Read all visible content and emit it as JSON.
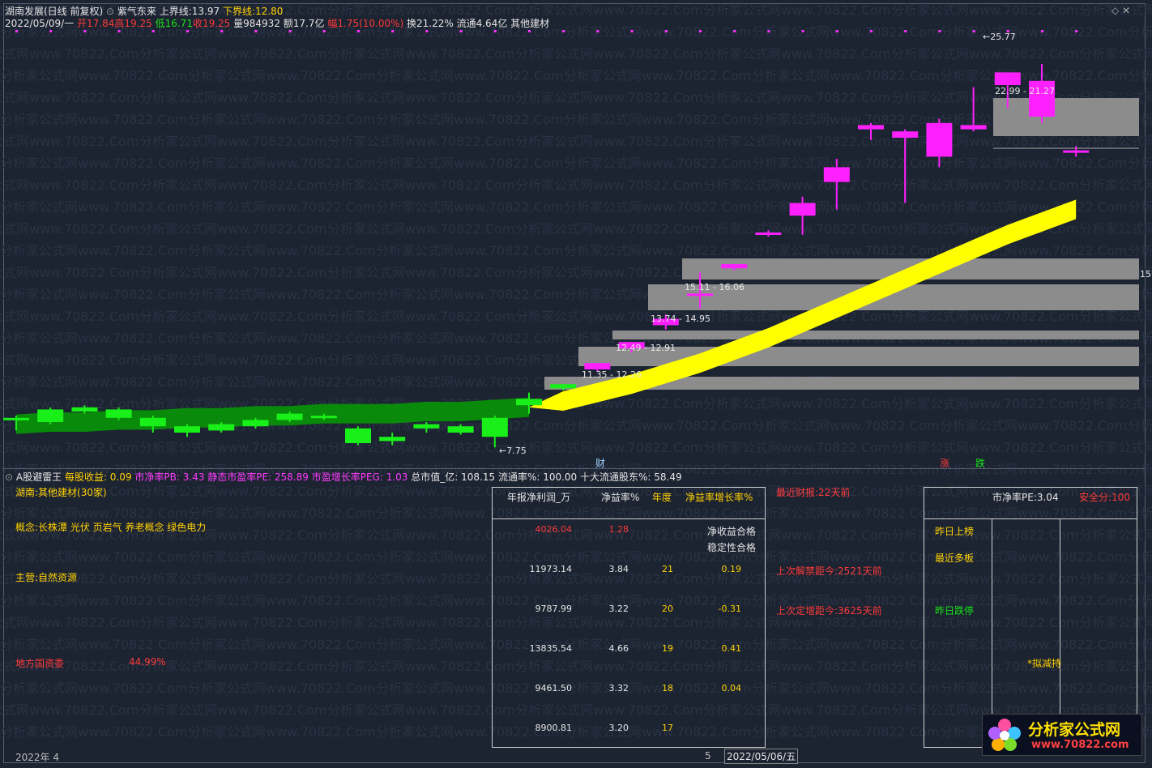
{
  "header": {
    "stock_name": "湖南发展(日线 前复权)",
    "indicator_name": "紫气东来",
    "upper_label": "上界线:",
    "upper_value": "13.97",
    "lower_label": "下界线:",
    "lower_value": "12.80",
    "date": "2022/05/09/一",
    "open": "开17.84",
    "high": "高19.25",
    "low": "低16.71",
    "close": "收19.25",
    "volume": "量984932",
    "amount": "额17.7亿",
    "change": "幅1.75(10.00%)",
    "turnover": "换21.22%",
    "float_value": "流通4.64亿",
    "sector": "其他建材"
  },
  "price_labels": {
    "top": "25.77",
    "bottom": "7.75",
    "z1": "22.99 - 21.27",
    "z2": "15.11 - 16.06",
    "z3": "13.74 - 14.95",
    "z4": "12.49 - 12.91",
    "z5": "11.35 - 12.26",
    "right_cut": "15"
  },
  "markers": {
    "cai": "财",
    "zhang": "涨",
    "die": "跌"
  },
  "watermark": "分析家公式网www.70822.Com",
  "chart_data": {
    "type": "candlestick",
    "series": [
      {
        "name": "k",
        "ohlc": [
          [
            7.6,
            7.8,
            7.1,
            7.7
          ],
          [
            7.5,
            8.2,
            7.4,
            8.1
          ],
          [
            8.0,
            8.3,
            7.9,
            8.2
          ],
          [
            8.1,
            8.2,
            7.6,
            7.7
          ],
          [
            7.7,
            7.8,
            7.0,
            7.3
          ],
          [
            7.3,
            7.4,
            6.8,
            7.0
          ],
          [
            7.1,
            7.5,
            7.0,
            7.4
          ],
          [
            7.3,
            7.7,
            7.2,
            7.6
          ],
          [
            7.6,
            8.0,
            7.5,
            7.9
          ],
          [
            7.8,
            7.9,
            7.6,
            7.7
          ],
          [
            7.2,
            7.3,
            6.4,
            6.5
          ],
          [
            6.8,
            7.0,
            6.4,
            6.6
          ],
          [
            7.2,
            7.5,
            7.0,
            7.4
          ],
          [
            7.0,
            7.4,
            6.9,
            7.3
          ],
          [
            7.7,
            7.8,
            6.3,
            6.8
          ],
          [
            8.6,
            8.9,
            7.9,
            8.3
          ],
          [
            9.1,
            9.3,
            9.0,
            9.3
          ],
          [
            10.0,
            10.3,
            9.9,
            10.3
          ],
          [
            11.0,
            11.3,
            10.8,
            11.3
          ],
          [
            12.1,
            12.6,
            11.9,
            12.4
          ],
          [
            13.6,
            14.6,
            12.9,
            13.6
          ],
          [
            14.8,
            15.0,
            14.7,
            15.0
          ],
          [
            16.4,
            16.6,
            16.3,
            16.5
          ],
          [
            17.3,
            18.2,
            16.4,
            17.9
          ],
          [
            18.9,
            20.0,
            17.6,
            19.6
          ],
          [
            21.6,
            21.7,
            20.9,
            21.4
          ],
          [
            21.0,
            21.4,
            17.9,
            21.3
          ],
          [
            20.1,
            21.9,
            19.6,
            21.7
          ],
          [
            21.6,
            23.4,
            21.3,
            21.4
          ],
          [
            23.5,
            24.1,
            22.4,
            24.1
          ],
          [
            23.7,
            24.5,
            21.7,
            22.0
          ],
          [
            20.4,
            20.6,
            20.1,
            20.4
          ]
        ]
      }
    ],
    "lines": [
      {
        "name": "band",
        "values": [
          7.4,
          7.5,
          7.5,
          7.6,
          7.6,
          7.7,
          7.7,
          7.8,
          7.8,
          7.9,
          7.9,
          7.9,
          8.0,
          8.0,
          8.1,
          8.2,
          8.5,
          8.9,
          9.3,
          9.8,
          10.3,
          10.9,
          11.5,
          12.2,
          12.9,
          13.6,
          14.3,
          15.0,
          15.7,
          16.4,
          17.0,
          17.6
        ]
      }
    ],
    "zones": [
      [
        "11.35",
        "12.26"
      ],
      [
        "12.49",
        "12.91"
      ],
      [
        "13.74",
        "14.95"
      ],
      [
        "15.11",
        "16.06"
      ],
      [
        "22.99",
        "21.27"
      ]
    ],
    "ylim": [
      6,
      26
    ],
    "xlabel_left": "2022年 4",
    "xlabel_mid": "5",
    "xlabel_right": "2022/05/06/五"
  },
  "bottom": {
    "title": "A股避雷王",
    "eps": "每股收益: 0.09",
    "pb": "市净率PB: 3.43",
    "pe": "静态市盈率PE: 258.89",
    "peg": "市盈增长率PEG: 1.03",
    "mcap": "总市值_亿: 108.15",
    "float_rate": "流通率%: 100.00",
    "top10": "十大流通股东%: 58.49",
    "region": "湖南:其他建材(30家)",
    "concept": "概念:长株潭 光伏 页岩气 养老概念 绿色电力",
    "main_biz": "主营:自然资源",
    "owner": "地方国资委",
    "owner_pct": "44.99%"
  },
  "table": {
    "headers": [
      "年报净利润_万",
      "净益率%",
      "年度",
      "净益率增长率%"
    ],
    "status1": "净收益合格",
    "status2": "稳定性合格",
    "rows": [
      [
        "4026.04",
        "1.28",
        "",
        ""
      ],
      [
        "11973.14",
        "3.84",
        "21",
        "0.19"
      ],
      [
        "9787.99",
        "3.22",
        "20",
        "-0.31"
      ],
      [
        "13835.54",
        "4.66",
        "19",
        "0.41"
      ],
      [
        "9461.50",
        "3.32",
        "18",
        "0.04"
      ],
      [
        "8900.81",
        "3.20",
        "17",
        ""
      ]
    ]
  },
  "mid_info": {
    "report": "最近财报:22天前",
    "unlock": "上次解禁距今:2521天前",
    "placement": "上次定增距今:3625天前"
  },
  "right_table": {
    "pe": "市净率PE:3.04",
    "safety": "安全分:100",
    "yesterday_list": "昨日上榜",
    "recent_boards": "最近多板",
    "yesterday_drop": "昨日跌停",
    "reduce": "*拟减持"
  },
  "logo": {
    "text": "分析家公式网",
    "url": "www.70822.com"
  }
}
